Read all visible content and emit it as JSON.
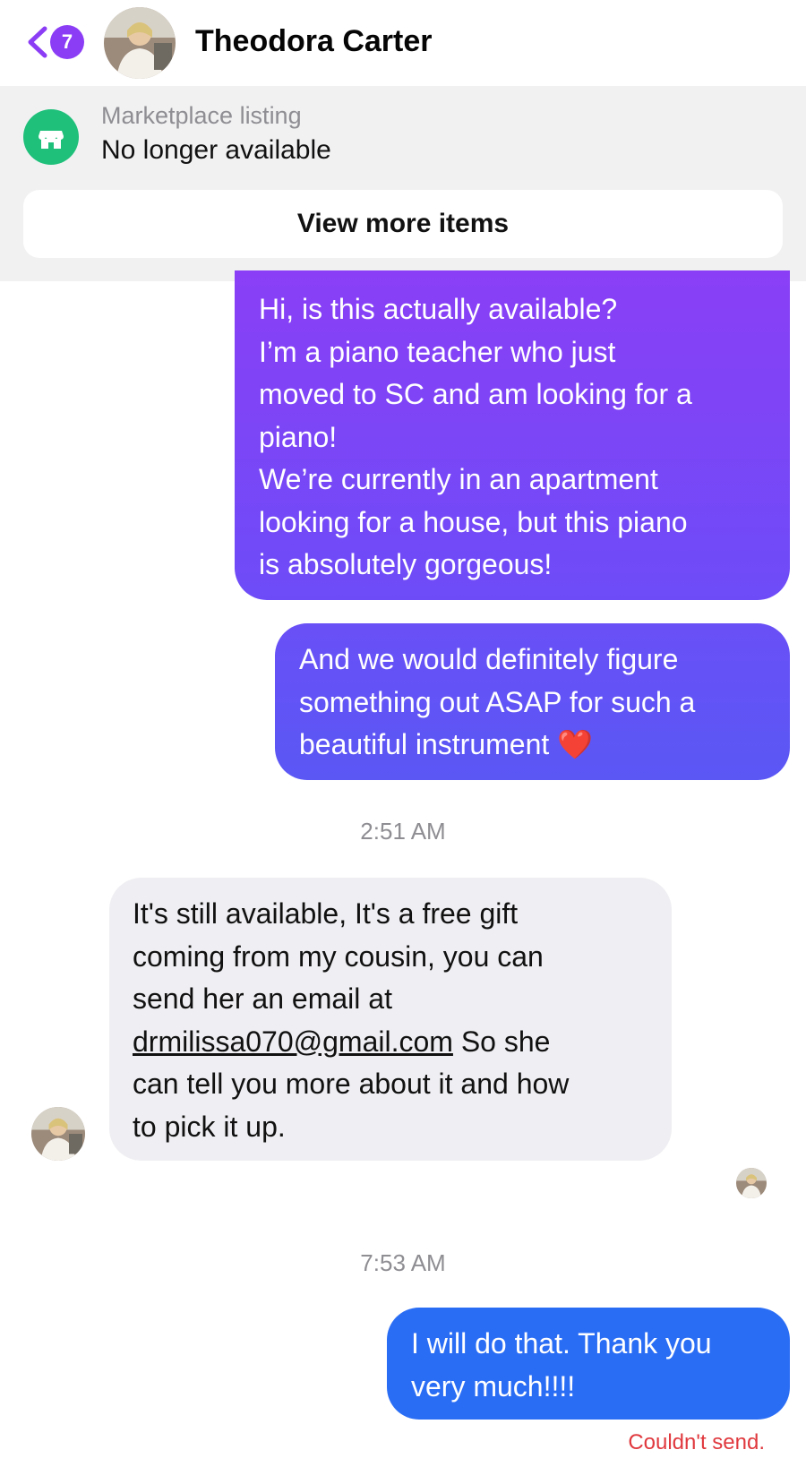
{
  "header": {
    "unread_count": "7",
    "contact_name": "Theodora Carter"
  },
  "listing": {
    "caption": "Marketplace listing",
    "status": "No longer available",
    "view_more_label": "View more items"
  },
  "messages": [
    {
      "sender": "me",
      "lines": [
        "Hi, is this actually available?",
        "I’m a piano teacher who just",
        "moved to SC and am looking for a",
        "piano!",
        "We’re currently in an apartment",
        "looking for a house, but this piano",
        "is absolutely gorgeous!"
      ]
    },
    {
      "sender": "me",
      "lines": [
        "And we would definitely figure",
        "something out ASAP for such a",
        "beautiful instrument "
      ],
      "emoji": "❤️"
    },
    {
      "timestamp": "2:51 AM"
    },
    {
      "sender": "them",
      "lines": [
        "It's still available, It's a free gift",
        "coming from my cousin,  you can",
        "send her an email at"
      ],
      "email": "drmilissa070@gmail.com",
      "after_email": " So she",
      "lines_after": [
        "can tell you more about it and how",
        "to pick it up."
      ]
    },
    {
      "timestamp": "7:53 AM"
    },
    {
      "sender": "me",
      "lines": [
        "I will do that. Thank you",
        "very much!!!!"
      ],
      "error": "Couldn't send."
    }
  ],
  "colors": {
    "accent": "#8b3df5",
    "store_green": "#1fc07a",
    "error_red": "#e0393e",
    "last_bubble": "#2a6df5"
  },
  "icons": [
    "chevron-left-icon",
    "store-icon",
    "heart-emoji"
  ]
}
